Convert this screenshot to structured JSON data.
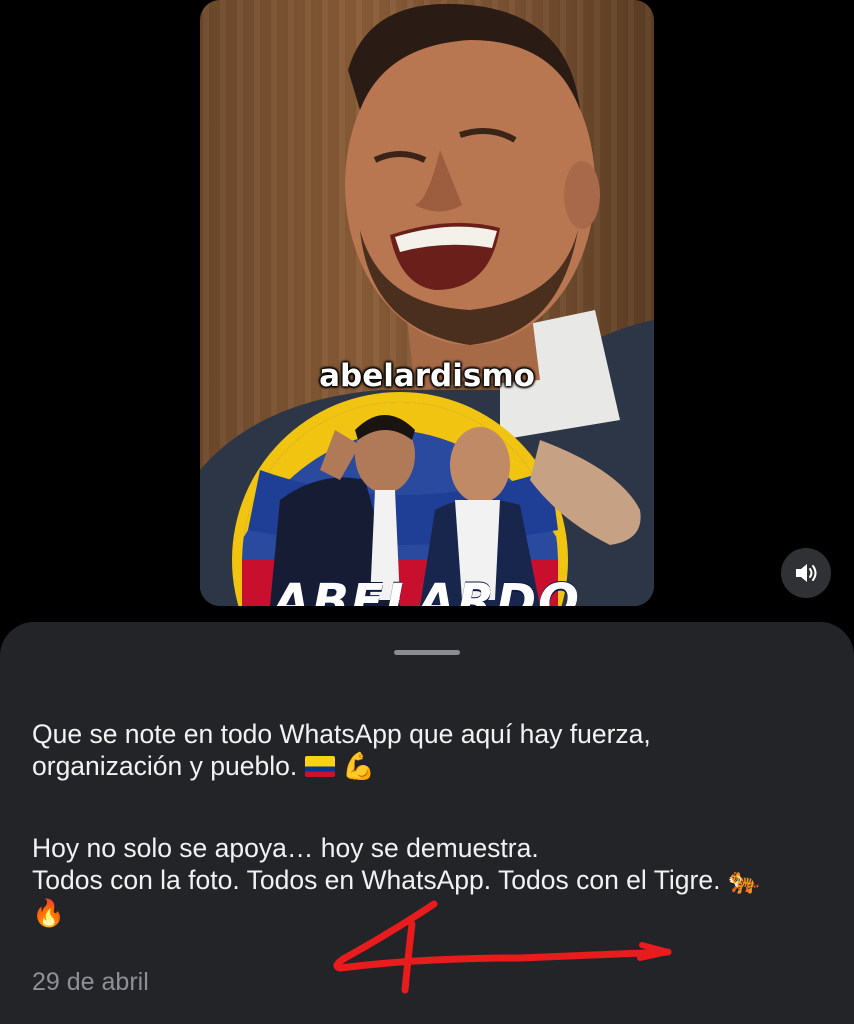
{
  "video": {
    "overlay_text": "abelardismo",
    "badge_text": "ABELARDO"
  },
  "controls": {
    "mute_icon": "speaker-icon"
  },
  "post": {
    "caption_line1": "Que se note en todo WhatsApp que aquí hay fuerza,",
    "caption_line2": "organización y pueblo.",
    "caption_line3": "Hoy no solo se apoya… hoy se demuestra.",
    "caption_line4": "Todos con la foto. Todos en WhatsApp. Todos con el Tigre.",
    "emoji_flag": "🇨🇴",
    "emoji_muscle": "💪",
    "emoji_tiger": "🐅",
    "emoji_fire": "🔥",
    "date": "29 de abril"
  },
  "colors": {
    "background": "#000000",
    "sheet": "#222427",
    "text": "#f2f2f2",
    "muted_text": "#8e9095",
    "annotation": "#e81c1c"
  }
}
